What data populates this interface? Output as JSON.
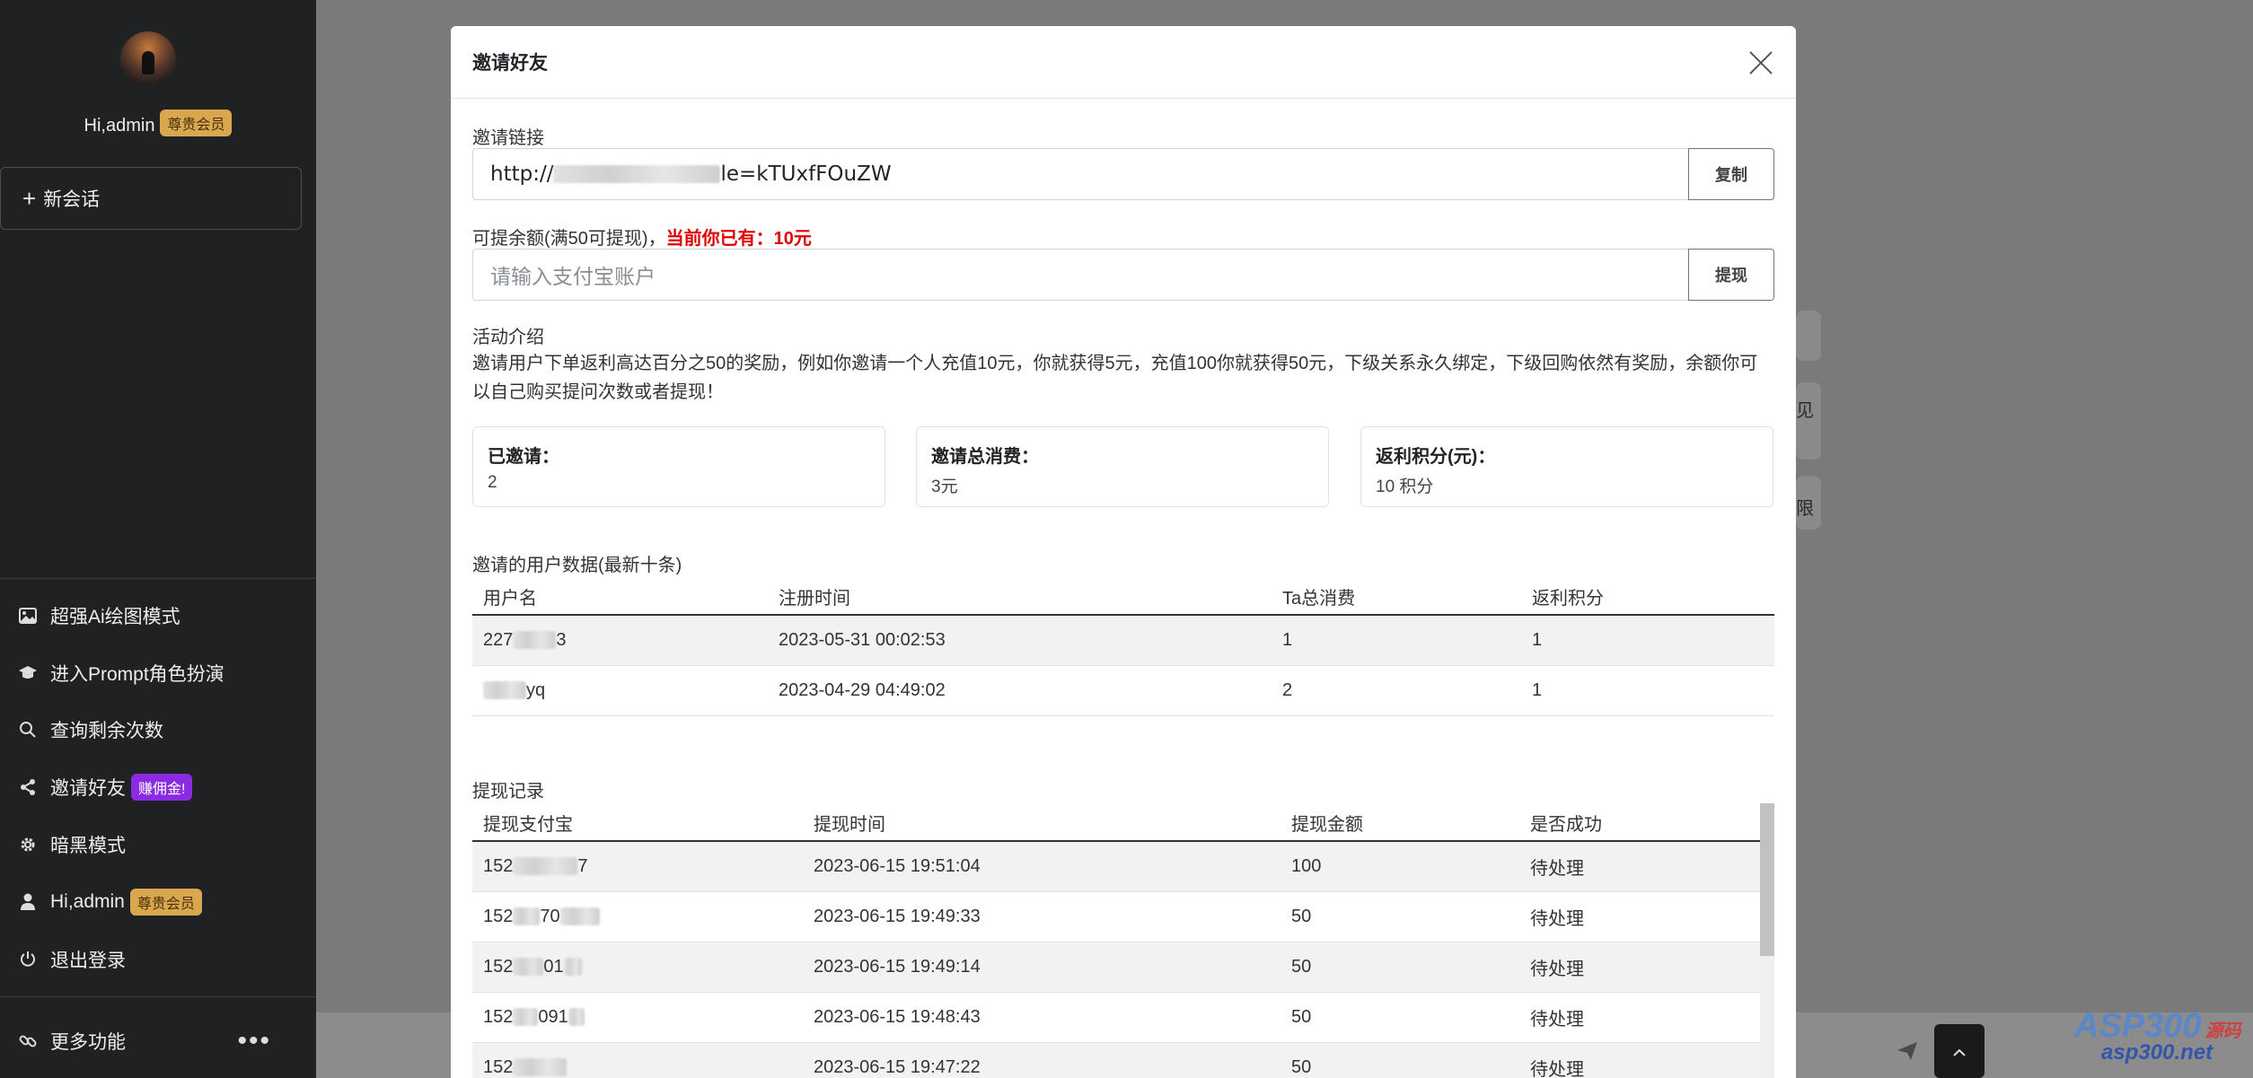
{
  "sidebar": {
    "greeting": "Hi,admin",
    "vip_badge": "尊贵会员",
    "new_chat": "新会话",
    "menu": [
      {
        "label": "超强Ai绘图模式",
        "icon": "image-icon"
      },
      {
        "label": "进入Prompt角色扮演",
        "icon": "graduation-cap-icon"
      },
      {
        "label": "查询剩余次数",
        "icon": "search-icon"
      },
      {
        "label": "邀请好友",
        "icon": "share-icon",
        "badge": "赚佣金!"
      },
      {
        "label": "暗黑模式",
        "icon": "gear-icon"
      },
      {
        "label": "Hi,admin",
        "icon": "user-icon",
        "badge": "尊贵会员"
      },
      {
        "label": "退出登录",
        "icon": "power-icon"
      }
    ],
    "more": "更多功能",
    "more_dots": "•••"
  },
  "background": {
    "peek_1": "见",
    "peek_2": "限",
    "send_icon": "send-icon",
    "scroll_top_icon": "chevron-up-icon"
  },
  "watermark": {
    "brand": "ASP300",
    "suffix": "源码",
    "domain": "asp300.net"
  },
  "modal": {
    "title": "邀请好友",
    "invite_link_label": "邀请链接",
    "invite_link_prefix": "http://",
    "invite_link_suffix": "le=kTUxfFOuZW",
    "copy_button": "复制",
    "balance_label": "可提余额(满50可提现)，",
    "balance_current": "当前你已有：10元",
    "alipay_placeholder": "请输入支付宝账户",
    "withdraw_button": "提现",
    "intro_title": "活动介绍",
    "intro_text": "邀请用户下单返利高达百分之50的奖励，例如你邀请一个人充值10元，你就获得5元，充值100你就获得50元，下级关系永久绑定，下级回购依然有奖励，余额你可以自己购买提问次数或者提现！",
    "stats": [
      {
        "title": "已邀请：",
        "value": "2"
      },
      {
        "title": "邀请总消费：",
        "value": "3元"
      },
      {
        "title": "返利积分(元)：",
        "value": "10 积分"
      }
    ],
    "users_title": "邀请的用户数据(最新十条)",
    "users_headers": [
      "用户名",
      "注册时间",
      "Ta总消费",
      "返利积分"
    ],
    "users_rows": [
      {
        "name_visible": "227",
        "name_tail": "3",
        "time": "2023-05-31 00:02:53",
        "spend": "1",
        "points": "1"
      },
      {
        "name_visible": "",
        "name_tail": "yq",
        "time": "2023-04-29 04:49:02",
        "spend": "2",
        "points": "1"
      }
    ],
    "withdraw_title": "提现记录",
    "withdraw_headers": [
      "提现支付宝",
      "提现时间",
      "提现金额",
      "是否成功"
    ],
    "withdraw_rows": [
      {
        "account": "152",
        "account_tail": "7",
        "time": "2023-06-15 19:51:04",
        "amount": "100",
        "status": "待处理"
      },
      {
        "account": "152",
        "account_tail": "70",
        "time": "2023-06-15 19:49:33",
        "amount": "50",
        "status": "待处理"
      },
      {
        "account": "152",
        "account_tail": "01",
        "time": "2023-06-15 19:49:14",
        "amount": "50",
        "status": "待处理"
      },
      {
        "account": "152",
        "account_tail": "091",
        "time": "2023-06-15 19:48:43",
        "amount": "50",
        "status": "待处理"
      },
      {
        "account": "152",
        "account_tail": "",
        "time": "2023-06-15 19:47:22",
        "amount": "50",
        "status": "待处理"
      }
    ]
  }
}
